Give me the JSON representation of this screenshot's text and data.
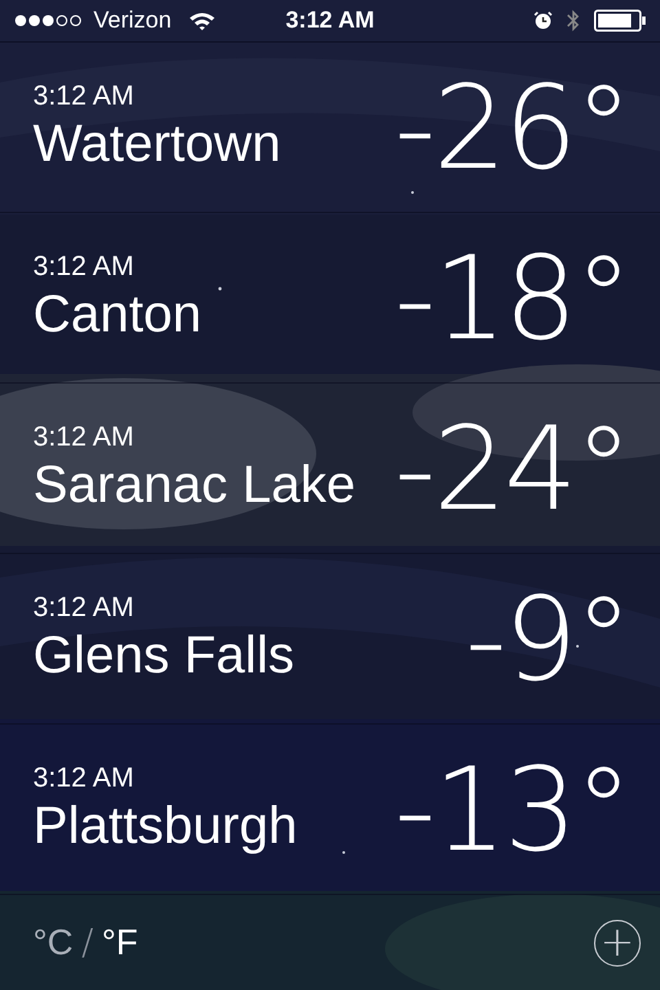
{
  "status_bar": {
    "carrier": "Verizon",
    "time": "3:12 AM"
  },
  "cities": [
    {
      "time": "3:12 AM",
      "name": "Watertown",
      "temperature": "-26°"
    },
    {
      "time": "3:12 AM",
      "name": "Canton",
      "temperature": "-18°"
    },
    {
      "time": "3:12 AM",
      "name": "Saranac Lake",
      "temperature": "-24°"
    },
    {
      "time": "3:12 AM",
      "name": "Glens Falls",
      "temperature": "-9°"
    },
    {
      "time": "3:12 AM",
      "name": "Plattsburgh",
      "temperature": "-13°"
    }
  ],
  "units": [
    {
      "label": "°C",
      "selected": false
    },
    {
      "label": "°F",
      "selected": true
    }
  ],
  "units_separator": "/",
  "add_button": {
    "label": "+"
  }
}
